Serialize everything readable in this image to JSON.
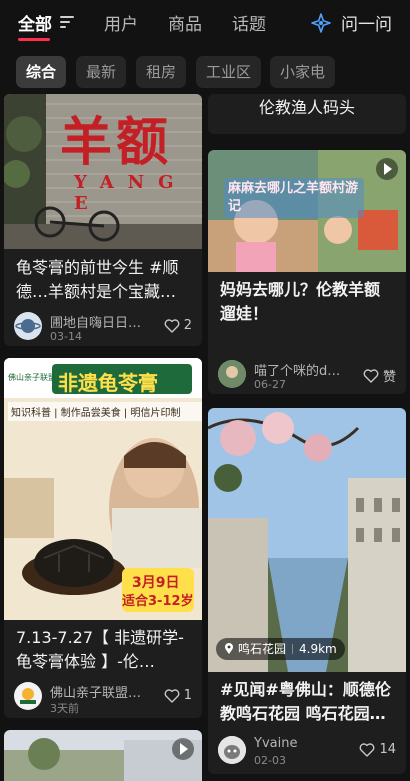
{
  "tabs": [
    {
      "label": "全部",
      "active": true
    },
    {
      "label": "用户"
    },
    {
      "label": "商品"
    },
    {
      "label": "话题"
    }
  ],
  "ask_label": "问一问",
  "chips": [
    "综合",
    "最新",
    "租房",
    "工业区",
    "小家电"
  ],
  "cards": {
    "left1": {
      "sign_text": "羊额",
      "sign_sub": "YANG E",
      "title": "龟苓膏的前世今生 #顺德…羊额村是个宝藏…",
      "author": "圃地自嗨日日…",
      "date": "03-14",
      "likes": "2"
    },
    "left2": {
      "badge": "佛山亲子联盟",
      "poster_title": "非遗龟苓膏",
      "poster_tags": "知识科普 | 制作品尝美食 | 明信片印制",
      "poster_date": "3月9日",
      "poster_age": "适合3-12岁",
      "title": "7.13-7.27【 非遗研学-龟苓膏体验 】-伦…",
      "author": "佛山亲子联盟…",
      "date": "3天前",
      "likes": "1"
    },
    "right0": {
      "title": "伦教渔人码头"
    },
    "right1": {
      "overlay_title": "麻麻去哪儿之羊额村游记",
      "title": "妈妈去哪儿？伦教羊额遛娃！",
      "author": "喵了个咪的d…",
      "date": "06-27",
      "likes": "赞"
    },
    "right2": {
      "location": "鸣石花园",
      "distance": "4.9km",
      "title": "#见闻#粤佛山：顺德伦教鸣石花园 鸣石花园…",
      "author": "Yvaine",
      "date": "02-03",
      "likes": "14"
    }
  },
  "colors": {
    "accent": "#ff2e4d",
    "background": "#121212",
    "card": "#1e1e1e"
  }
}
